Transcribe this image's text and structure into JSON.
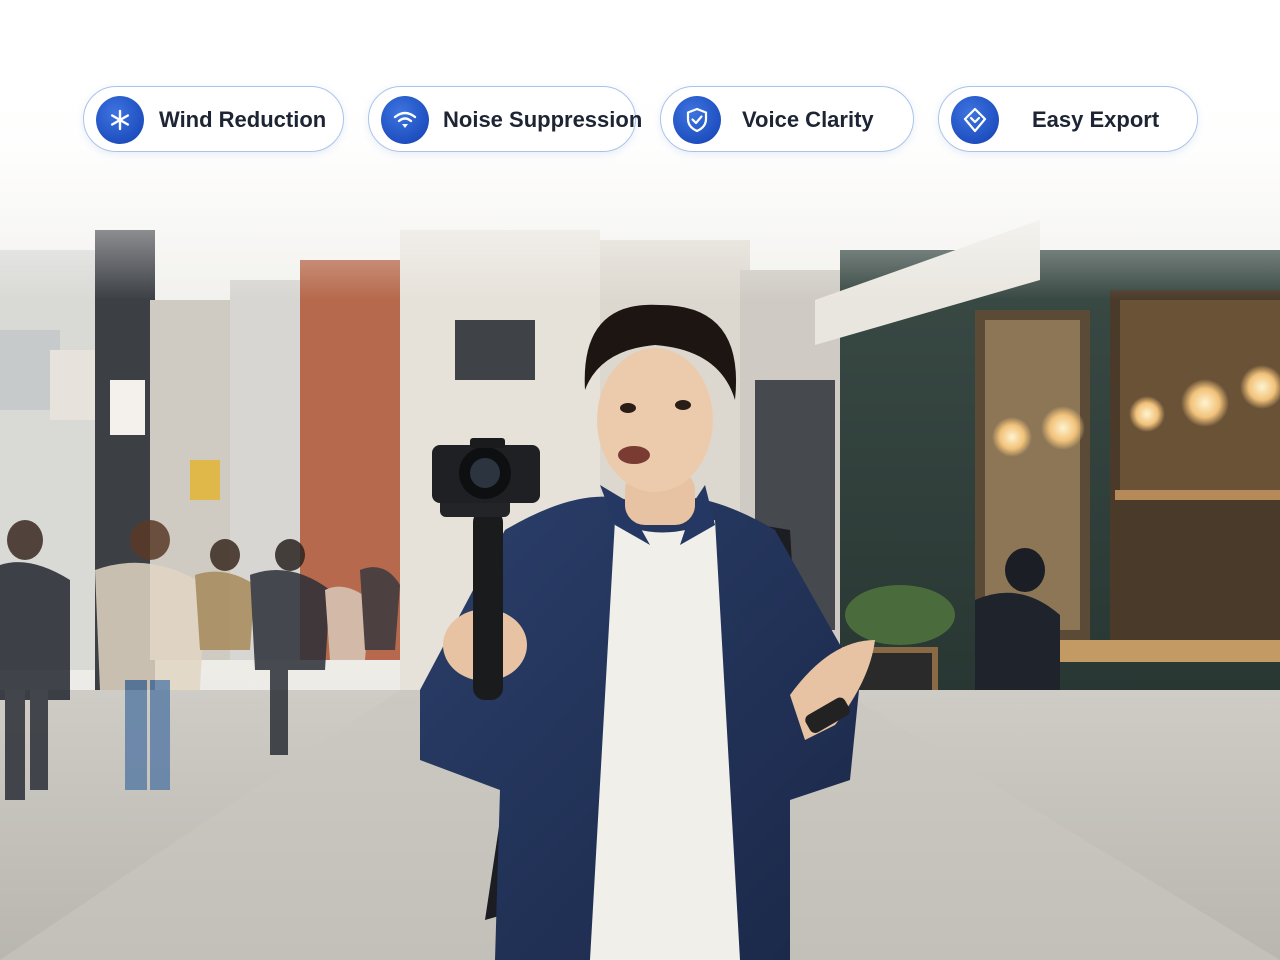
{
  "features": [
    {
      "label": "Wind Reduction",
      "icon": "snowflake-icon"
    },
    {
      "label": "Noise Suppression",
      "icon": "wifi-icon"
    },
    {
      "label": "Voice Clarity",
      "icon": "shield-check-icon"
    },
    {
      "label": "Easy Export",
      "icon": "export-badge-icon"
    }
  ],
  "colors": {
    "accent": "#1f4fc0",
    "pill_border": "#a9c4ea",
    "text": "#1d2433"
  }
}
